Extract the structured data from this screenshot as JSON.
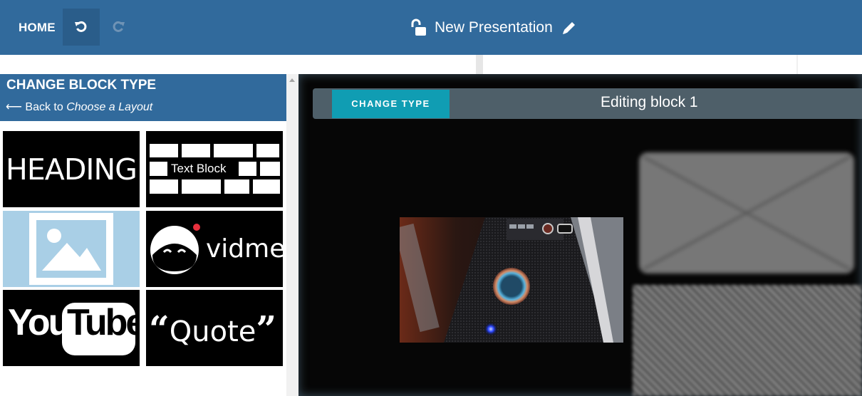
{
  "header": {
    "home_label": "HOME",
    "undo_icon": "undo-icon",
    "redo_icon": "redo-icon",
    "title": "New Presentation",
    "lock_icon": "unlock-icon",
    "edit_icon": "pencil-icon",
    "colors": {
      "bar": "#316a9c",
      "undo_active_bg": "#2a5d8a"
    }
  },
  "panel": {
    "title": "CHANGE BLOCK TYPE",
    "back_arrow": "⟵",
    "back_prefix": "Back to",
    "back_target": "Choose a Layout",
    "tiles": {
      "heading": "HEADING",
      "text_block": "Text Block",
      "image": "image-icon",
      "vidme": "vidme",
      "youtube_left": "You",
      "youtube_right": "Tube",
      "quote_open": "“",
      "quote_word": "Quote",
      "quote_close": "”"
    }
  },
  "editor": {
    "change_type_label": "CHANGE TYPE",
    "editing_label": "Editing block 1",
    "colors": {
      "header": "#4e5f69",
      "button": "#109db3",
      "canvas": "#060606"
    }
  }
}
